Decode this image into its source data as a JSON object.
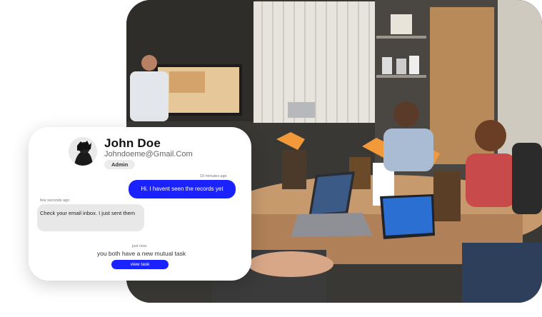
{
  "profile": {
    "name": "John Doe",
    "email": "Johndoeme@Gmail.Com",
    "role_badge": "Admin"
  },
  "messages": [
    {
      "direction": "outgoing",
      "timestamp": "10 minutes ago",
      "text": "Hi. I havent seen the records yet"
    },
    {
      "direction": "incoming",
      "timestamp": "few seconds ago",
      "text": "Check your email inbox. I just sent them"
    }
  ],
  "notification": {
    "timestamp": "just now",
    "text": "you both have a new mutual task",
    "button_label": "view task"
  },
  "colors": {
    "accent": "#1a22ff",
    "incoming_bubble": "#e8e8e8",
    "card_background": "#ffffff"
  },
  "icons": {
    "avatar": "profile-photo"
  }
}
